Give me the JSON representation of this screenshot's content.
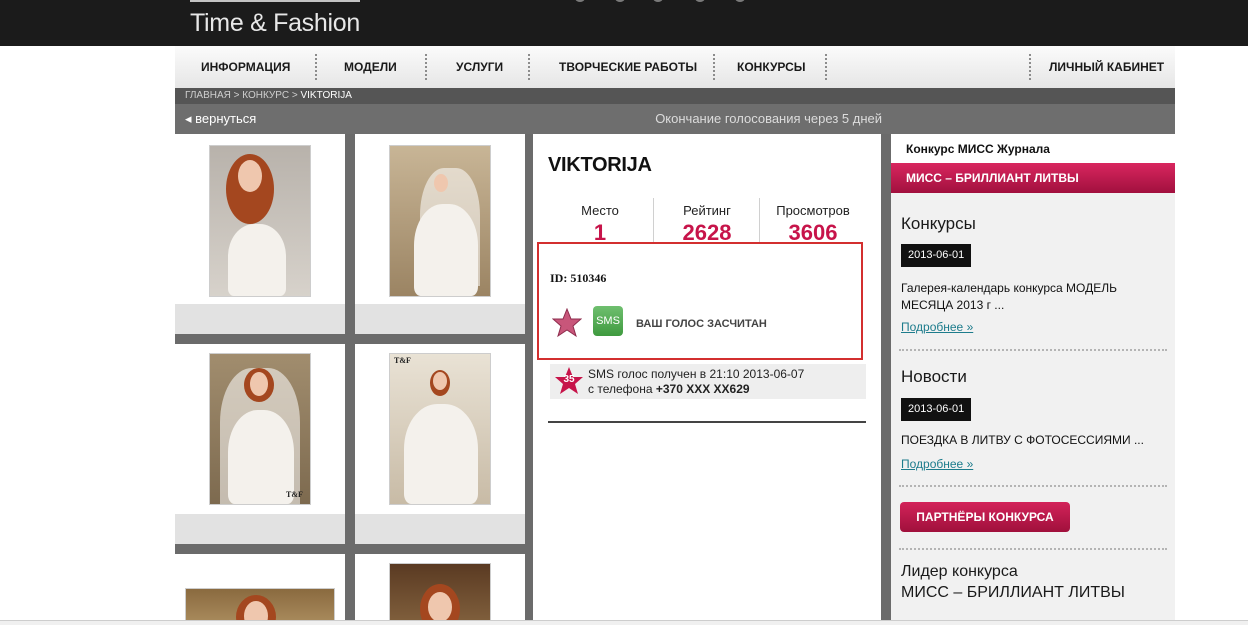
{
  "header": {
    "logo_text": "Time & Fashion"
  },
  "nav": {
    "items": [
      "ИНФОРМАЦИЯ",
      "МОДЕЛИ",
      "УСЛУГИ",
      "ТВОРЧЕСКИЕ РАБОТЫ",
      "КОНКУРСЫ"
    ],
    "account": "ЛИЧНЫЙ КАБИНЕТ"
  },
  "breadcrumb": {
    "home": "ГЛАВНАЯ",
    "sep": ">",
    "contest": "КОНКУРС",
    "current": "VIKTORIJA"
  },
  "backbar": {
    "back_arrow": "◂",
    "back_label": "вернуться",
    "vote_end": "Окончание голосования через 5 дней"
  },
  "gallery": {
    "watermark": "T&F"
  },
  "profile": {
    "name": "VIKTORIJA",
    "stats": [
      {
        "label": "Место",
        "value": "1"
      },
      {
        "label": "Рейтинг",
        "value": "2628"
      },
      {
        "label": "Просмотров",
        "value": "3606"
      }
    ],
    "id_text": "ID: 510346",
    "sms_button": "SMS",
    "vote_status": "ВАШ ГОЛОС ЗАСЧИТАН",
    "sms_log": {
      "badge": "35",
      "line1": "SMS голос получен в 21:10  2013-06-07",
      "line2_prefix": "с телефона",
      "phone": "+370 XXX XX629"
    }
  },
  "sidebar": {
    "contest_label": "Конкурс МИСС Журнала",
    "contest_name": "МИСС – БРИЛЛИАНТ ЛИТВЫ",
    "contests": {
      "title": "Конкурсы",
      "date": "2013-06-01",
      "text": "Галерея-календарь конкурса МОДЕЛЬ МЕСЯЦА 2013 г ...",
      "more": "Подробнее »"
    },
    "news": {
      "title": "Новости",
      "date": "2013-06-01",
      "text": "ПОЕЗДКА В ЛИТВУ С ФОТОСЕССИЯМИ ...",
      "more": "Подробнее »"
    },
    "partners_button": "ПАРТНЁРЫ КОНКУРСА",
    "leader": {
      "line1": "Лидер конкурса",
      "line2": "МИСС – БРИЛЛИАНТ ЛИТВЫ"
    }
  },
  "colors": {
    "accent": "#c7144a",
    "header_bg": "#1b1b1b",
    "nav_bg": "#eeeeee",
    "sms_green": "#4aa84a",
    "highlight_border": "#d32f2f",
    "link": "#1d7c8c"
  }
}
